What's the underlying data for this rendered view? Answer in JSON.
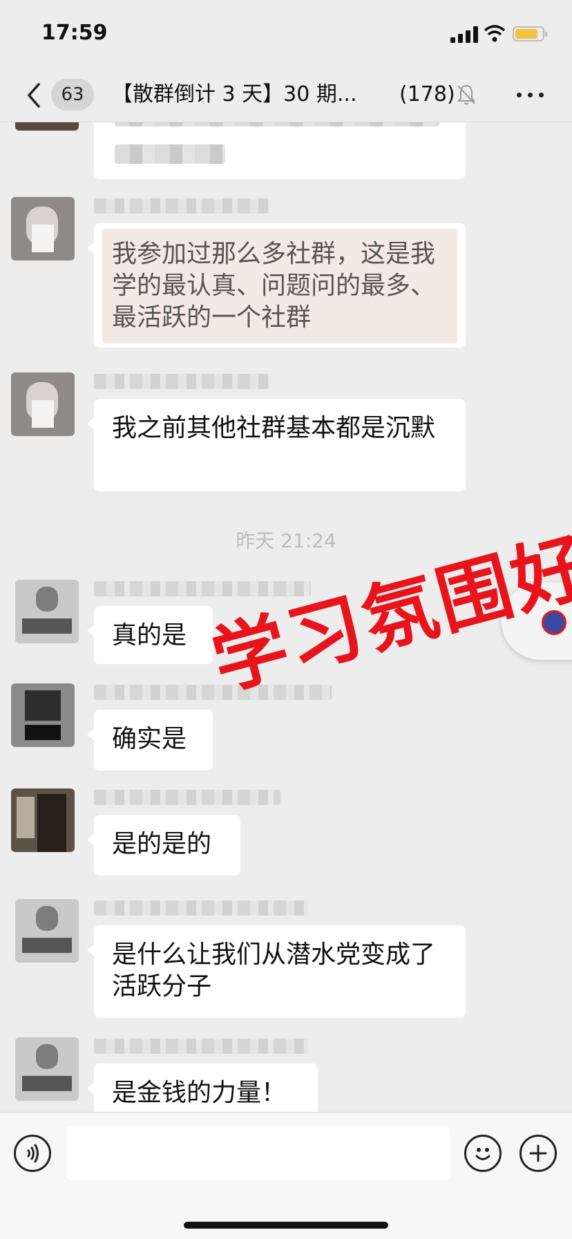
{
  "status_bar": {
    "time": "17:59"
  },
  "nav": {
    "back_badge": "63",
    "title": "【散群倒计 3 天】30 期...",
    "member_count": "(178)"
  },
  "messages": [
    {
      "text": ""
    },
    {
      "text": "我参加过那么多社群，这是我学的最认真、问题问的最多、最活跃的一个社群"
    },
    {
      "text": "我之前其他社群基本都是沉默"
    },
    {
      "text": "真的是"
    },
    {
      "text": "确实是"
    },
    {
      "text": "是的是的"
    },
    {
      "text": "是什么让我们从潜水党变成了活跃分子"
    },
    {
      "text": "是金钱的力量！"
    }
  ],
  "timestamp": "昨天 21:24",
  "watermark": "学习氛围好",
  "colors": {
    "accent_red": "#e8141b",
    "background": "#ededed",
    "bubble": "#ffffff",
    "quote_bg": "#f3ebe3"
  },
  "icons": [
    "back-icon",
    "mute-icon",
    "more-icon",
    "voice-icon",
    "emoji-icon",
    "plus-icon"
  ]
}
